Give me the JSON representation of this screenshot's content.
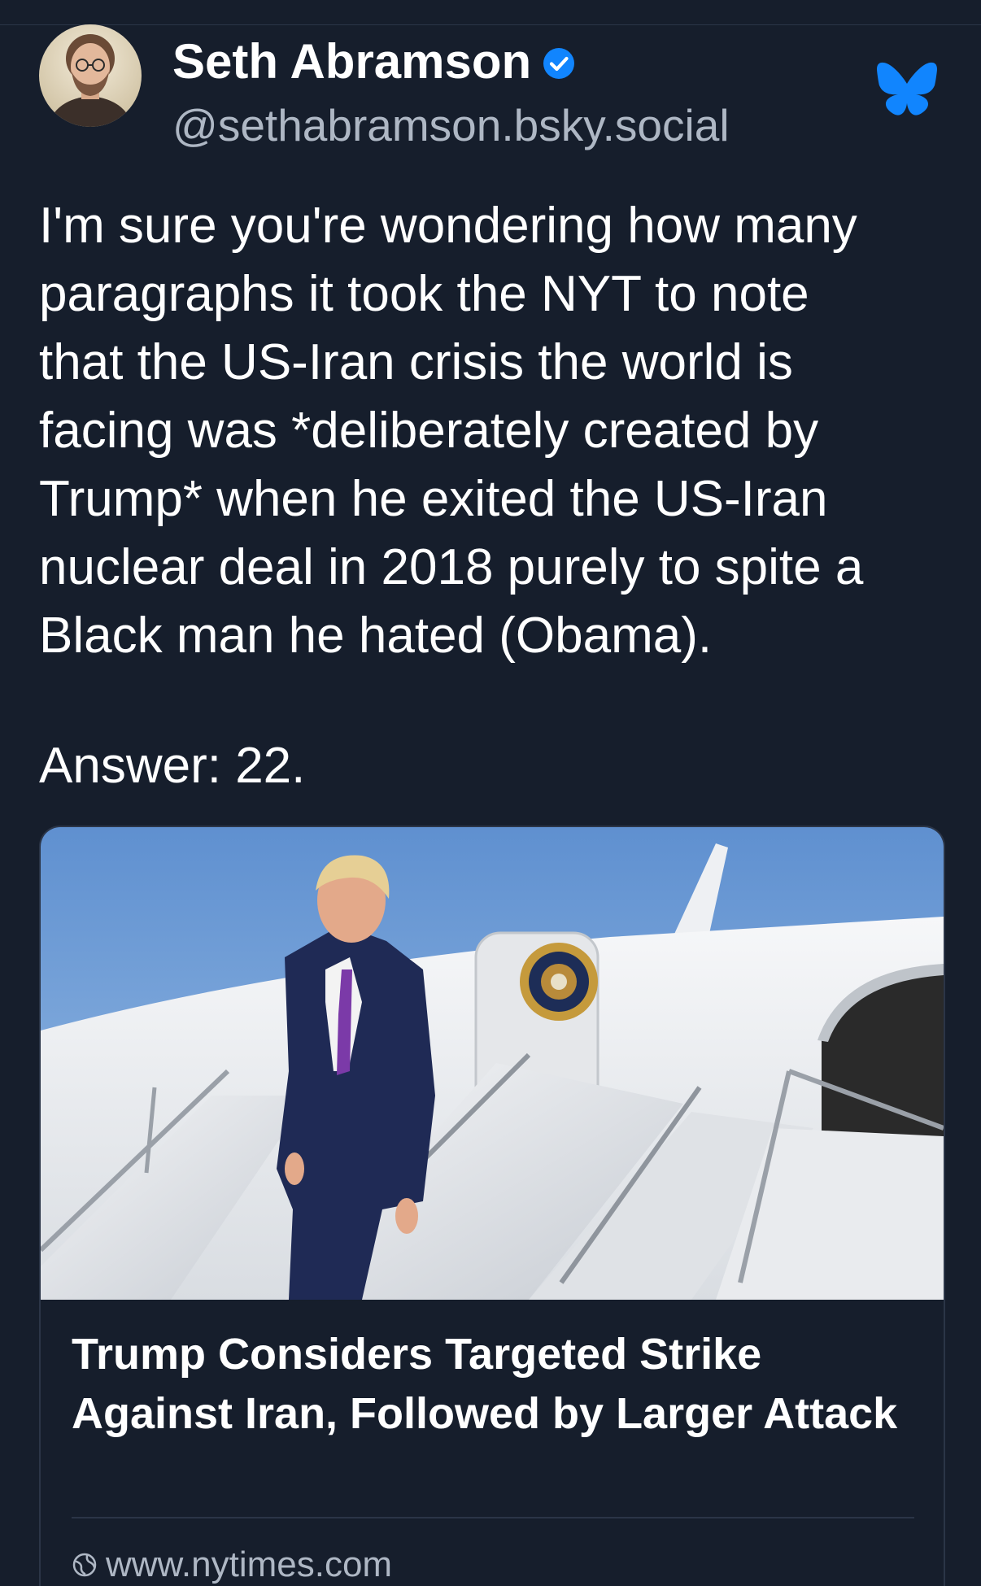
{
  "post": {
    "author": {
      "display_name": "Seth Abramson",
      "handle": "@sethabramson.bsky.social",
      "verified": true,
      "avatar_icon": "user-avatar-photo"
    },
    "brand_icon": "bluesky-butterfly-icon",
    "text_lines": [
      "I'm sure you're wondering how many",
      "paragraphs it took the NYT to note",
      "that the US-Iran crisis the world is",
      "facing was *deliberately created by",
      "Trump* when he exited the US-Iran",
      "nuclear deal in 2018 purely to spite a",
      "Black man he hated (Obama)."
    ],
    "answer": "Answer: 22.",
    "link_card": {
      "image_icon": "news-photo",
      "title": "Trump Considers Targeted Strike Against Iran, Followed by Larger Attack",
      "domain": "www.nytimes.com",
      "domain_icon": "globe-icon"
    }
  },
  "colors": {
    "background": "#161e2c",
    "text_primary": "#ffffff",
    "text_secondary": "#aeb7c4",
    "accent_blue": "#1185fe",
    "border": "#2b3547"
  }
}
